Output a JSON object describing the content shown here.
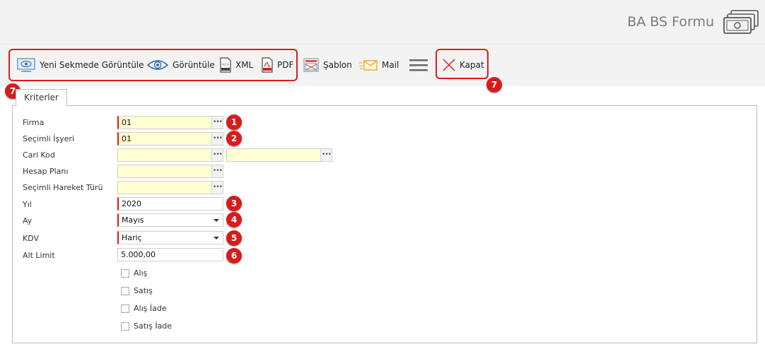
{
  "header": {
    "title": "BA BS Formu",
    "icon": "money-stack-icon"
  },
  "toolbar": {
    "open_new_tab": "Yeni Sekmede Görüntüle",
    "view": "Görüntüle",
    "xml": "XML",
    "pdf": "PDF",
    "template": "Şablon",
    "mail": "Mail",
    "close": "Kapat"
  },
  "badges": {
    "b1": "1",
    "b2": "2",
    "b3": "3",
    "b4": "4",
    "b5": "5",
    "b6": "6",
    "b7": "7"
  },
  "tabs": {
    "criteria": "Kriterler"
  },
  "form": {
    "firma": {
      "label": "Firma",
      "value": "01"
    },
    "isyeri": {
      "label": "Seçimli İşyeri",
      "value": "01"
    },
    "cari_kod": {
      "label": "Cari Kod",
      "value": "",
      "value2": ""
    },
    "hesap_plani": {
      "label": "Hesap Planı",
      "value": ""
    },
    "hareket_turu": {
      "label": "Seçimli Hareket Türü",
      "value": ""
    },
    "yil": {
      "label": "Yıl",
      "value": "2020"
    },
    "ay": {
      "label": "Ay",
      "value": "Mayıs"
    },
    "kdv": {
      "label": "KDV",
      "value": "Hariç"
    },
    "alt_limit": {
      "label": "Alt Limit",
      "value": "5.000,00"
    },
    "checkboxes": [
      {
        "label": "Alış",
        "checked": false
      },
      {
        "label": "Satış",
        "checked": false
      },
      {
        "label": "Alış İade",
        "checked": false
      },
      {
        "label": "Satış İade",
        "checked": false
      }
    ]
  },
  "colors": {
    "highlight": "#e21b1b",
    "badge": "#d81b1b",
    "field_bg": "#fffed3"
  }
}
